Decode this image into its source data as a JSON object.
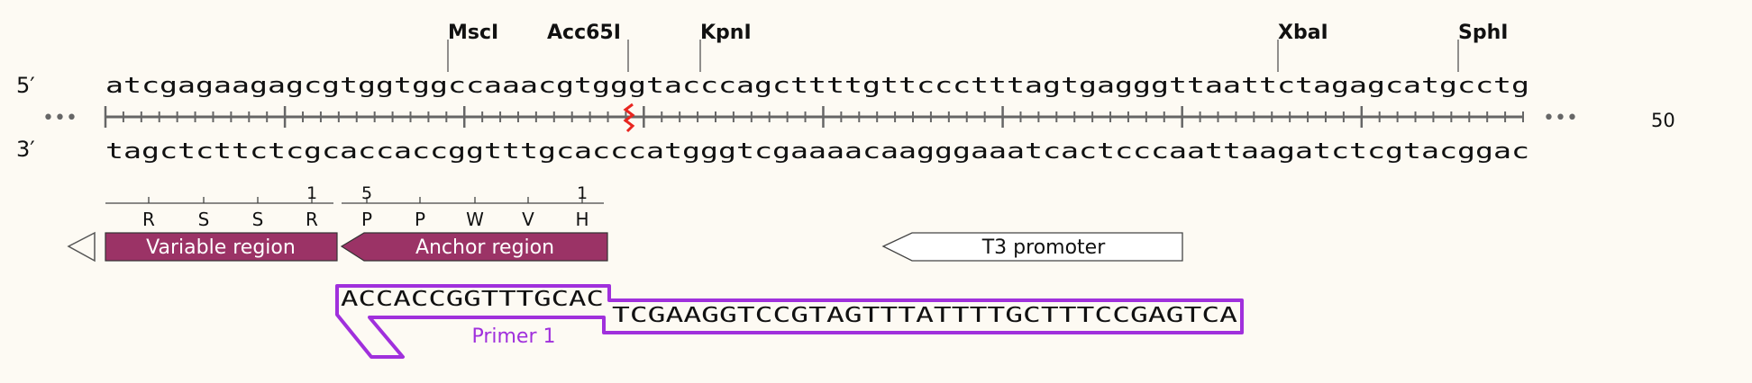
{
  "enzymes": [
    {
      "name": "MscI"
    },
    {
      "name": "Acc65I"
    },
    {
      "name": "KpnI"
    },
    {
      "name": "XbaI"
    },
    {
      "name": "SphI"
    }
  ],
  "strand_labels": {
    "top": "5′",
    "bottom": "3′"
  },
  "sequence": {
    "top": "atcgagaagagcgtggtggccaaacgtgggtacccagcttttgttccctttagtgagggttaattctagagcatgcctg",
    "bottom": "tagctcttctcgcaccaccggtttgcacccatgggtcgaaaacaagggaaatcactcccaattaagatctcgtacggac"
  },
  "ruler": {
    "ellipsis": "•••",
    "position_label": "50"
  },
  "translations": [
    {
      "residues": [
        "R",
        "S",
        "S",
        "R"
      ],
      "number": "1"
    },
    {
      "residues": [
        "P",
        "P",
        "W",
        "V",
        "H"
      ],
      "numbers": [
        "5",
        "1"
      ]
    }
  ],
  "features": {
    "variable_region": "Variable region",
    "anchor_region": "Anchor region",
    "t3_promoter": "T3 promoter"
  },
  "primer": {
    "name": "Primer 1",
    "seq_part1": "ACCACCGGTTTGCAC",
    "seq_part2": "TCGAAGGTCCGTAGTTTATTTTGCTTTCCGAGTCA"
  },
  "colors": {
    "feature_fill": "#9b3366",
    "primer": "#a030dc",
    "cut_mark": "#e8251f",
    "ruler": "#666666",
    "text": "#111111"
  }
}
